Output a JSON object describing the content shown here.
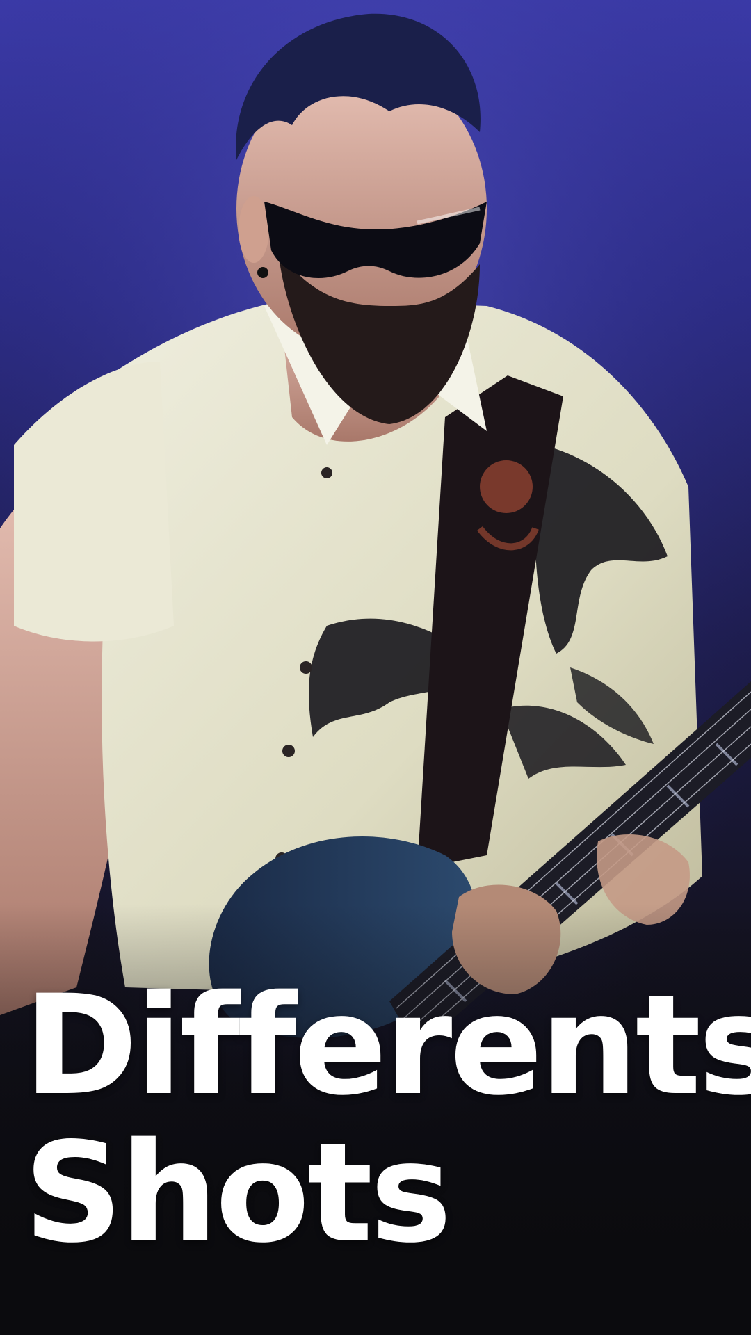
{
  "caption": {
    "line1": "Differents",
    "line2": "Shots"
  },
  "scene": {
    "subject-icon": "guitarist-photo",
    "background_color": "#2c2c86",
    "shirt_color": "#e9e6d2",
    "text_color": "#ffffff"
  }
}
